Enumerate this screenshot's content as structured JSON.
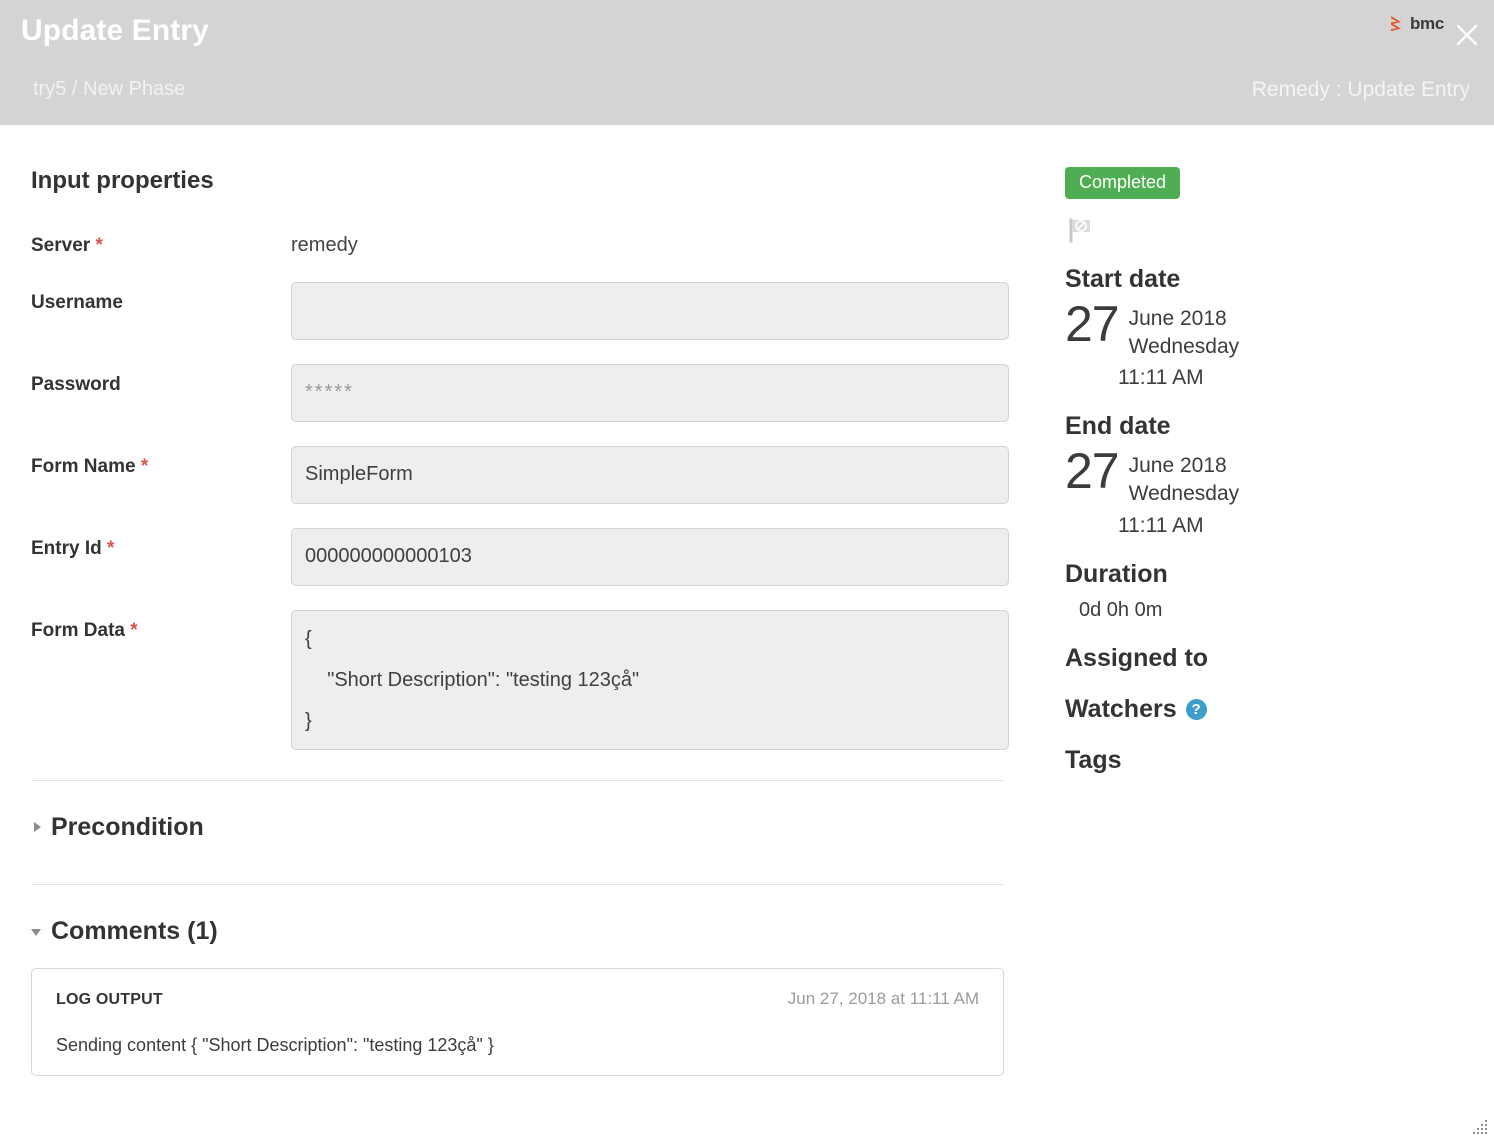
{
  "header": {
    "title": "Update Entry",
    "breadcrumb": "try5 / New Phase",
    "right_label": "Remedy : Update Entry",
    "logo_word": "bmc",
    "close_icon": "close-icon",
    "bg_color": "#d4d4d4",
    "logo_accent": "#e4572e"
  },
  "main": {
    "section_title": "Input properties",
    "fields": [
      {
        "label": "Server",
        "required": true,
        "type": "static",
        "value": "remedy"
      },
      {
        "label": "Username",
        "required": false,
        "type": "input",
        "value": "",
        "placeholder": ""
      },
      {
        "label": "Password",
        "required": false,
        "type": "input",
        "value": "",
        "placeholder": "*****"
      },
      {
        "label": "Form Name",
        "required": true,
        "type": "input",
        "value": "SimpleForm",
        "placeholder": ""
      },
      {
        "label": "Entry Id",
        "required": true,
        "type": "input",
        "value": "000000000000103",
        "placeholder": ""
      },
      {
        "label": "Form Data",
        "required": true,
        "type": "textarea",
        "value": "{\n    \"Short Description\": \"testing 123çå\"\n}",
        "placeholder": ""
      }
    ],
    "precondition": {
      "title": "Precondition",
      "expanded": false
    },
    "comments": {
      "title": "Comments (1)",
      "expanded": true,
      "items": [
        {
          "author": "LOG OUTPUT",
          "timestamp": "Jun 27, 2018 at 11:11 AM",
          "body": "Sending content { \"Short Description\": \"testing 123çå\" }"
        }
      ]
    }
  },
  "sidebar": {
    "status_badge": "Completed",
    "status_color": "#4fae53",
    "flag_icon": "flag-blocked-icon",
    "start_date": {
      "heading": "Start date",
      "day": "27",
      "month_year": "June 2018",
      "weekday": "Wednesday",
      "time": "11:11 AM"
    },
    "end_date": {
      "heading": "End date",
      "day": "27",
      "month_year": "June 2018",
      "weekday": "Wednesday",
      "time": "11:11 AM"
    },
    "duration": {
      "heading": "Duration",
      "value": "0d 0h 0m"
    },
    "assigned_to": {
      "heading": "Assigned to"
    },
    "watchers": {
      "heading": "Watchers",
      "help_icon": "?"
    },
    "tags": {
      "heading": "Tags"
    }
  }
}
